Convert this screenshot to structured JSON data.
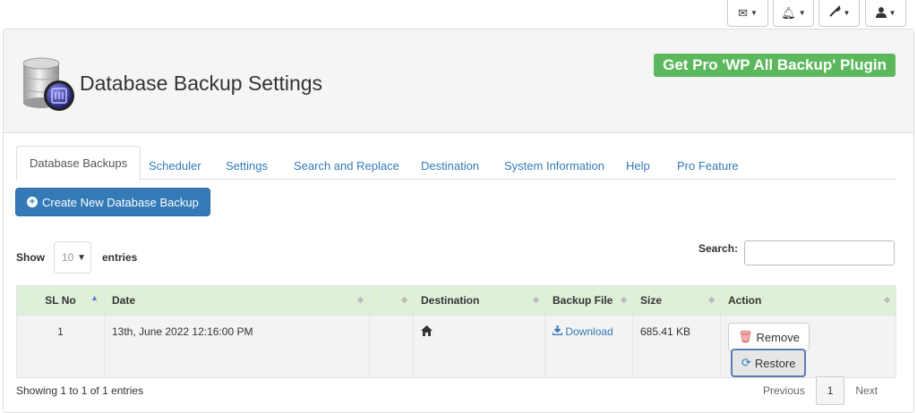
{
  "toolbar": {
    "items": [
      {
        "name": "mail-menu",
        "icon": "envelope-icon"
      },
      {
        "name": "notifications-menu",
        "icon": "bell-icon"
      },
      {
        "name": "tools-menu",
        "icon": "wrench-icon"
      },
      {
        "name": "user-menu",
        "icon": "user-icon"
      }
    ]
  },
  "header": {
    "title": "Database Backup Settings",
    "pro_button": "Get Pro 'WP All Backup' Plugin",
    "logo_icon": "database-icon"
  },
  "tabs": [
    {
      "label": "Database Backups",
      "active": true
    },
    {
      "label": "Scheduler"
    },
    {
      "label": "Settings"
    },
    {
      "label": "Search and Replace"
    },
    {
      "label": "Destination"
    },
    {
      "label": "System Information"
    },
    {
      "label": "Help"
    },
    {
      "label": "Pro Feature"
    }
  ],
  "create_button": "Create New Database Backup",
  "length": {
    "show": "Show",
    "value": "10",
    "entries": "entries"
  },
  "search": {
    "label": "Search:",
    "value": ""
  },
  "table": {
    "headers": [
      "SL No",
      "Date",
      "",
      "Destination",
      "Backup File",
      "Size",
      "Action"
    ],
    "rows": [
      {
        "sl": "1",
        "date": "13th, June 2022 12:16:00 PM",
        "destination_icon": "home-icon",
        "backup_file": "Download",
        "size": "685.41 KB",
        "remove": "Remove",
        "restore": "Restore"
      }
    ]
  },
  "footer": {
    "info": "Showing 1 to 1 of 1 entries",
    "previous": "Previous",
    "page": "1",
    "next": "Next"
  },
  "colors": {
    "primary": "#337ab7",
    "success": "#5cb85c",
    "table_header": "#dff0d8",
    "danger": "#d9534f"
  }
}
